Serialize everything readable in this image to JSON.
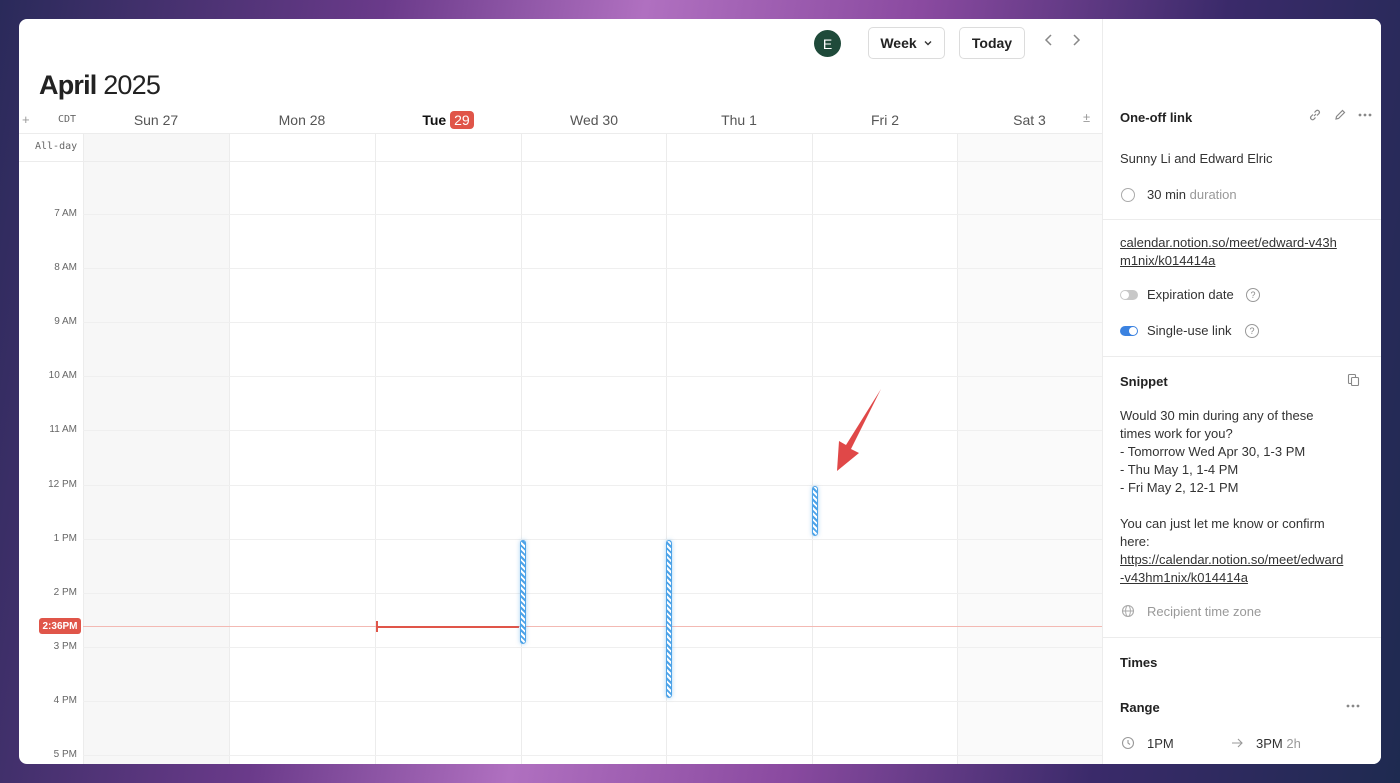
{
  "header": {
    "avatar_initial": "E",
    "view_label": "Week",
    "today_label": "Today",
    "prev_icon": "chevron-left-icon",
    "next_icon": "chevron-right-icon"
  },
  "month": {
    "name": "April",
    "year": "2025"
  },
  "timezone": "CDT",
  "allday_label": "All-day",
  "days": [
    {
      "label": "Sun 27"
    },
    {
      "label": "Mon 28"
    },
    {
      "label": "Tue",
      "badge": "29",
      "today": true
    },
    {
      "label": "Wed 30"
    },
    {
      "label": "Thu 1"
    },
    {
      "label": "Fri 2"
    },
    {
      "label": "Sat 3"
    }
  ],
  "hours": [
    "7 AM",
    "8 AM",
    "9 AM",
    "10 AM",
    "11 AM",
    "12 PM",
    "1 PM",
    "2 PM",
    "3 PM",
    "4 PM",
    "5 PM"
  ],
  "current_time": "2:36PM",
  "availability_slots": [
    {
      "day": "Wed 30",
      "start": "1 PM",
      "end": "3 PM"
    },
    {
      "day": "Thu 1",
      "start": "1 PM",
      "end": "4 PM"
    },
    {
      "day": "Fri 2",
      "start": "12 PM",
      "end": "1 PM"
    }
  ],
  "panel": {
    "title": "One-off link",
    "participants": "Sunny Li and Edward Elric",
    "duration_value": "30 min",
    "duration_label": "duration",
    "link_line1": "calendar.notion.so/meet/edward-v43h",
    "link_line2": "m1nix/k014414a",
    "expiration_label": "Expiration date",
    "expiration_on": false,
    "single_use_label": "Single-use link",
    "single_use_on": true,
    "snippet_title": "Snippet",
    "snippet_lines": [
      "Would 30 min during any of these",
      "times work for you?",
      "- Tomorrow Wed Apr 30, 1-3 PM",
      "- Thu May 1, 1-4 PM",
      "- Fri May 2, 12-1 PM",
      "",
      "You can just let me know or confirm",
      "here:"
    ],
    "snippet_link_line1": "https://calendar.notion.so/meet/edward",
    "snippet_link_line2": "-v43hm1nix/k014414a",
    "recipient_tz_label": "Recipient time zone",
    "times_title": "Times",
    "range_title": "Range",
    "range_start": "1PM",
    "range_end": "3PM",
    "range_duration": "2h"
  },
  "colors": {
    "accent_red": "#e05549",
    "slot_blue": "#4da3e8",
    "toggle_on": "#3b82e0",
    "avatar_bg": "#1f4a3a"
  }
}
